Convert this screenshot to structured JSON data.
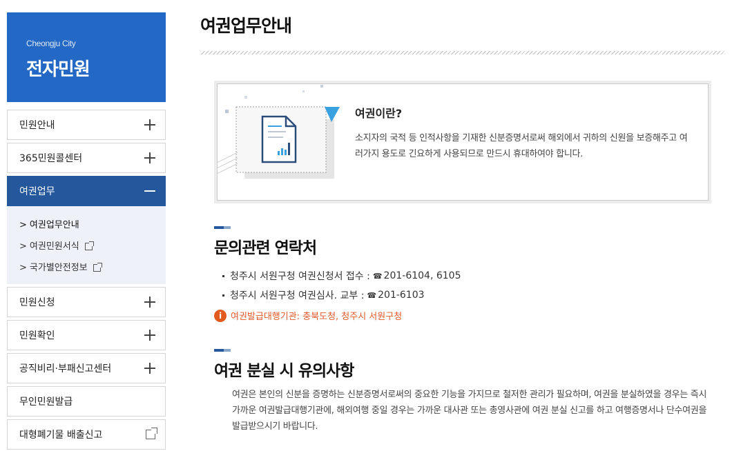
{
  "brand": {
    "en": "Cheongju City",
    "ko": "전자민원"
  },
  "menu": {
    "items": [
      {
        "label": "민원안내"
      },
      {
        "label": "365민원콜센터"
      },
      {
        "label": "여권업무"
      },
      {
        "label": "민원신청"
      },
      {
        "label": "민원확인"
      },
      {
        "label": "공직비리·부패신고센터"
      },
      {
        "label": "무인민원발급"
      },
      {
        "label": "대형폐기물 배출신고"
      }
    ],
    "sub": [
      {
        "label": "여권업무안내"
      },
      {
        "label": "여권민원서식"
      },
      {
        "label": "국가별안전정보"
      }
    ],
    "arrow": ">"
  },
  "page": {
    "title": "여권업무안내"
  },
  "info": {
    "title": "여권이란?",
    "body": "소지자의 국적 등 인적사항을 기재한 신분증명서로써 해외에서 귀하의 신원을 보증해주고 여러가지 용도로 긴요하게 사용되므로 만드시 휴대하여야 합니다."
  },
  "contact": {
    "heading": "문의관련 연락처",
    "lines": [
      {
        "label": "청주시 서원구청 여권신청서 접수 :",
        "tel": "201-6104, 6105"
      },
      {
        "label": "청주시 서원구청 여권심사. 교부 :",
        "tel": "201-6103"
      }
    ],
    "phone_glyph": "☎",
    "notice_icon": "i",
    "notice": "여권발급대행기관: 충북도청, 청주시 서원구청"
  },
  "lost": {
    "heading": "여권 분실 시 유의사항",
    "body": "여권은 본인의 신분을 증명하는 신분증명서로써의 중요한 기능을 가지므로 철저한 관리가 필요하며, 여권을 분실하였을 경우는 즉시 가까운 여권발급대행기관에, 해외여행 중일 경우는 가까운 대사관 또는 총영사관에 여권 분실 신고를 하고 여행증명서나 단수여권을 발급받으시기 바랍니다."
  },
  "colors": {
    "brand": "#2368c4",
    "active": "#24579c",
    "notice": "#e2592b"
  }
}
